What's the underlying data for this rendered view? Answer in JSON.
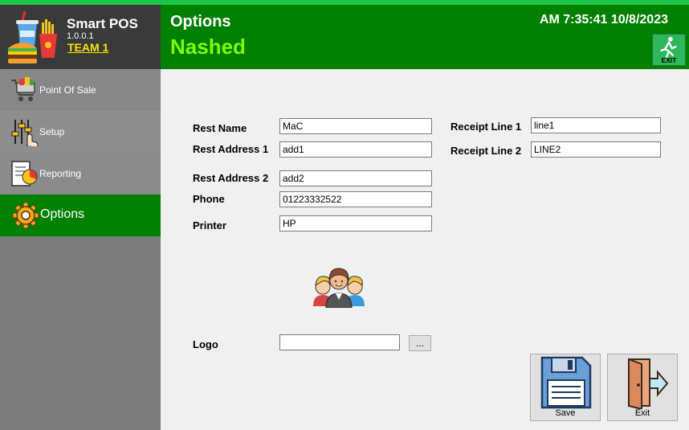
{
  "brand": {
    "name": "Smart POS",
    "version": "1.0.0.1",
    "team": "TEAM 1"
  },
  "sidebar": {
    "items": [
      {
        "label": "Point Of Sale",
        "icon": "shopping-cart-icon"
      },
      {
        "label": "Setup",
        "icon": "sliders-icon"
      },
      {
        "label": "Reporting",
        "icon": "report-icon"
      },
      {
        "label": "Options",
        "icon": "gear-icon",
        "active": true
      }
    ]
  },
  "header": {
    "title": "Options",
    "user": "Nashed",
    "clock": "AM 7:35:41 10/8/2023",
    "exit_label": "EXIT"
  },
  "form": {
    "rest_name": {
      "label": "Rest Name",
      "value": "MaC"
    },
    "rest_address_1": {
      "label": "Rest Address 1",
      "value": "add1"
    },
    "rest_address_2": {
      "label": "Rest Address 2",
      "value": "add2"
    },
    "phone": {
      "label": "Phone",
      "value": "01223332522"
    },
    "printer": {
      "label": "Printer",
      "value": "HP"
    },
    "receipt_line_1": {
      "label": "Receipt Line 1",
      "value": "line1"
    },
    "receipt_line_2": {
      "label": "Receipt Line 2",
      "value": "LINE2"
    },
    "logo": {
      "label": "Logo",
      "value": "",
      "browse_label": "..."
    }
  },
  "buttons": {
    "save_label": "Save",
    "exit_label": "Exit"
  },
  "colors": {
    "header_green": "#008000",
    "user_green": "#7cfc00",
    "sidebar_gray": "#7d7d7d",
    "brand_dark": "#3a3a3a",
    "team_yellow": "#f6e500"
  }
}
